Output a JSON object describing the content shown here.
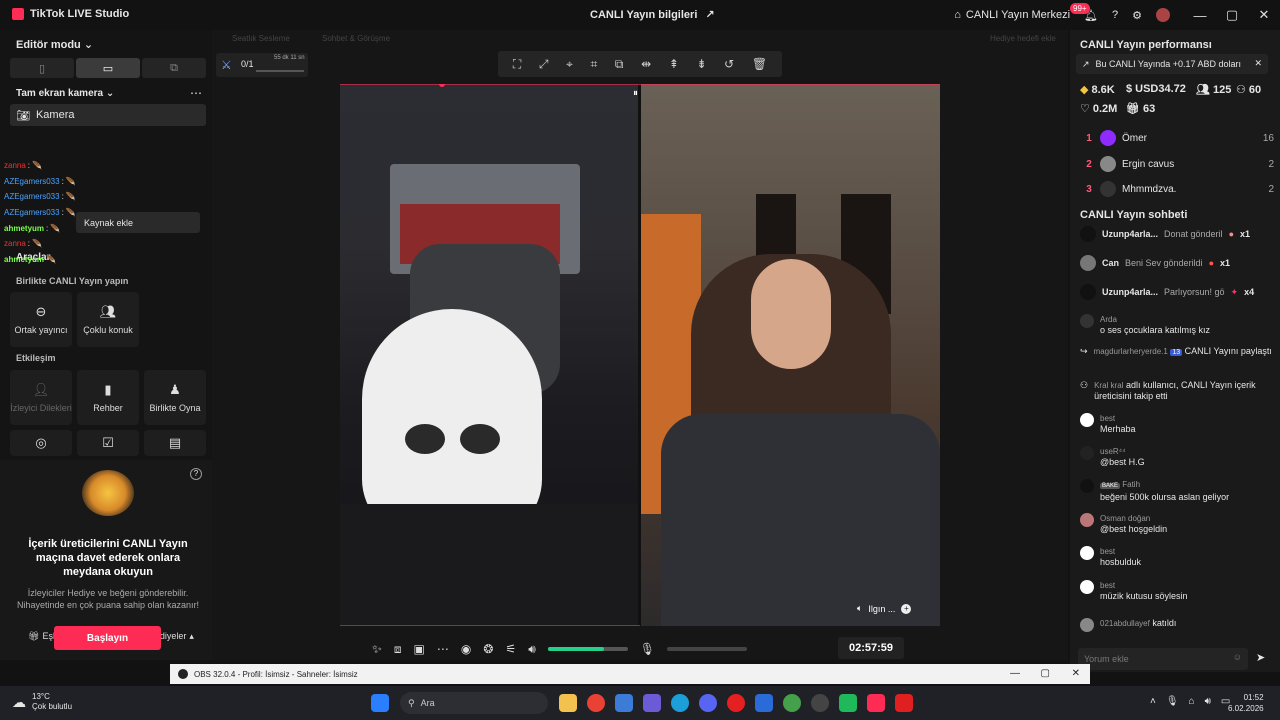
{
  "titlebar": {
    "app_title": "TikTok LIVE Studio",
    "center_title": "CANLI Yayın bilgileri",
    "live_center": "CANLI Yayın Merkezi",
    "notif_badge": "99+"
  },
  "left": {
    "editor_mode": "Editör modu",
    "fullscreen_cam": "Tam ekran kamera",
    "camera": "Kamera",
    "add_source": "Kaynak ekle",
    "tools": "Araçlar",
    "collab_section": "Birlikte CANLI Yayın yapın",
    "collab_tiles": [
      "Ortak yayıncı",
      "Çoklu konuk"
    ],
    "interaction_section": "Etkileşim",
    "interaction_tiles": [
      "İzleyici Dilekleri",
      "Rehber",
      "Birlikte Oyna"
    ],
    "chat_overlay": [
      {
        "user": "zanna",
        "color": "#e33"
      },
      {
        "user": "AZEgamers033",
        "color": "#4aa3ff"
      },
      {
        "user": "AZEgamers033",
        "color": "#4aa3ff"
      },
      {
        "user": "AZEgamers033",
        "color": "#4aa3ff"
      },
      {
        "user": "ahmetyum",
        "color": "#7dff4a"
      },
      {
        "user": "zanna",
        "color": "#e33"
      },
      {
        "user": "ahmetyum",
        "color": "#7dff4a"
      }
    ],
    "invite_title": "İçerik üreticilerini CANLI Yayın maçına davet ederek onlara meydana okuyun",
    "invite_desc": "İzleyiciler Hediye ve beğeni gönderebilir. Nihayetinde en çok puana sahip olan kazanır!",
    "match_option": "Eşleştirme seçeneği: Tüm Hediyeler",
    "start_button": "Başlayın"
  },
  "center": {
    "hidden_tab_1": "Seatlık Sesleme",
    "hidden_tab_2": "Sohbet & Görüşme",
    "gift_goal": "Hediye hedefi ekle",
    "counter": "0/1",
    "counter_time": "55 dk 11 sn",
    "feed_caption": "Ilgın ...",
    "timer": "02:57:59",
    "volume_level": 0.7
  },
  "right": {
    "perf_title": "CANLI Yayın performansı",
    "notice": "Bu CANLI Yayında +0.17 ABD doları",
    "stats": {
      "coins": "8.6K",
      "usd": "USD34.72",
      "viewers": "125",
      "users": "60",
      "likes": "0.2M",
      "gifts": "63"
    },
    "ranking": [
      {
        "rank": "1",
        "name": "Ömer",
        "score": "16",
        "color": "#8e2bff"
      },
      {
        "rank": "2",
        "name": "Ergin cavus",
        "score": "2",
        "color": "#888"
      },
      {
        "rank": "3",
        "name": "Mhmmdzva.",
        "score": "2",
        "color": "#333"
      }
    ],
    "chat_title": "CANLI Yayın sohbeti",
    "gifts": [
      {
        "user": "Uzunp4arla...",
        "action": "Donat gönderil",
        "count": "x1"
      },
      {
        "user": "Can",
        "action": "Beni Sev gönderildi",
        "count": "x1"
      },
      {
        "user": "Uzunp4arla...",
        "action": "Parlıyorsun! gö",
        "count": "x4"
      }
    ],
    "chat": [
      {
        "user": "Arda",
        "text": "o ses çocuklara katılmış kız"
      },
      {
        "user": "magdurlarheryerde.1",
        "text": "CANLI Yayını paylaştı",
        "level": "13"
      },
      {
        "user": "Kral kral",
        "text": "adlı kullanıcı, CANLI Yayın içerik üreticisini takip etti"
      },
      {
        "user": "best",
        "text": "Merhaba"
      },
      {
        "user": "useR⁴⁴",
        "text": "@best H.G"
      },
      {
        "user": "Fatih",
        "text": "beğeni 500k olursa aslan geliyor",
        "tag": "BAKE"
      },
      {
        "user": "Osman doğan",
        "text": "@best hoşgeldin"
      },
      {
        "user": "best",
        "text": "hosbulduk"
      },
      {
        "user": "best",
        "text": "müzik kutusu söylesin"
      },
      {
        "user": "021abdullayef",
        "text": "katıldı"
      }
    ],
    "comment_placeholder": "Yorum ekle"
  },
  "obs": {
    "title": "OBS 32.0.4 - Profil: İsimsiz - Sahneler: İsimsiz"
  },
  "taskbar": {
    "weather_temp": "13°C",
    "weather_desc": "Çok bulutlu",
    "search": "Ara",
    "time": "01:52",
    "date": "6.02.2026"
  }
}
